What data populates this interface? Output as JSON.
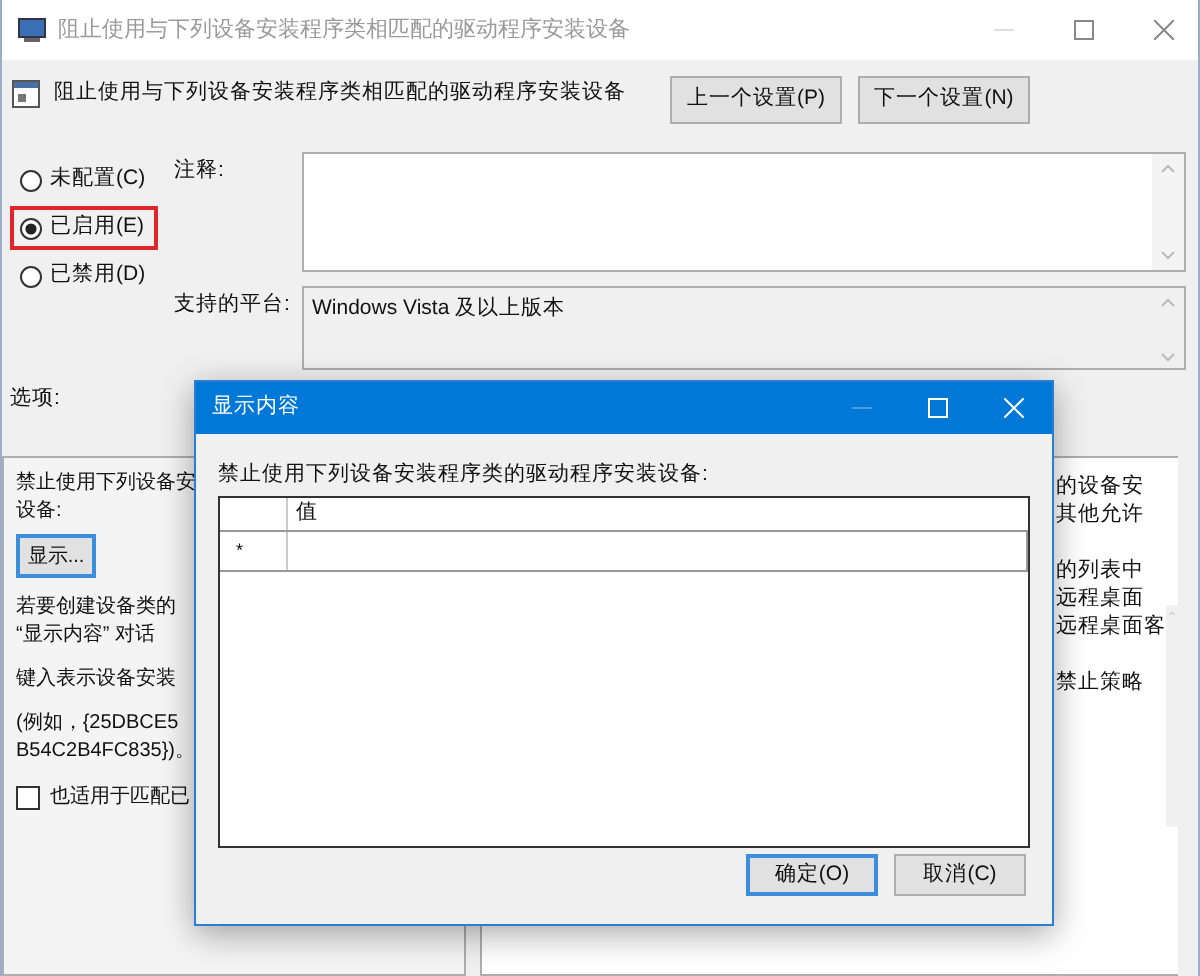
{
  "window": {
    "title": "阻止使用与下列设备安装程序类相匹配的驱动程序安装设备"
  },
  "header": {
    "title": "阻止使用与下列设备安装程序类相匹配的驱动程序安装设备",
    "buttons": [
      {
        "label": "上一个设置(P)"
      },
      {
        "label": "下一个设置(N)"
      }
    ]
  },
  "state_options": [
    {
      "label": "未配置(C)",
      "selected": false,
      "highlighted": false
    },
    {
      "label": "已启用(E)",
      "selected": true,
      "highlighted": true
    },
    {
      "label": "已禁用(D)",
      "selected": false,
      "highlighted": false
    }
  ],
  "comment": {
    "label": "注释:"
  },
  "platform": {
    "label": "支持的平台:",
    "value": "Windows Vista 及以上版本"
  },
  "options": {
    "label": "选项:",
    "items": [
      {
        "kind": "text",
        "lines": [
          "禁止使用下列设备安",
          "设备:"
        ]
      },
      {
        "kind": "button",
        "label": "显示..."
      },
      {
        "kind": "text",
        "lines": [
          "若要创建设备类的",
          "“显示内容” 对话"
        ]
      },
      {
        "kind": "text",
        "lines": [
          "键入表示设备安装"
        ]
      },
      {
        "kind": "text",
        "lines": [
          "(例如，{25DBCE5",
          "B54C2B4FC835})。"
        ]
      },
      {
        "kind": "checkbox",
        "label": "也适用于匹配已",
        "checked": false
      }
    ]
  },
  "help": {
    "paragraphs": [
      [
        "的设备安",
        "其他允许"
      ],
      [
        "的列表中",
        "远程桌面",
        "远程桌面客"
      ],
      [
        "禁止策略"
      ]
    ]
  },
  "dialog": {
    "title": "显示内容",
    "prompt": "禁止使用下列设备安装程序类的驱动程序安装设备:",
    "table": {
      "column": "值",
      "rows": [
        {
          "marker": "*"
        }
      ]
    },
    "buttons": [
      {
        "label": "确定(O)",
        "default": true
      },
      {
        "label": "取消(C)",
        "default": false
      }
    ]
  }
}
